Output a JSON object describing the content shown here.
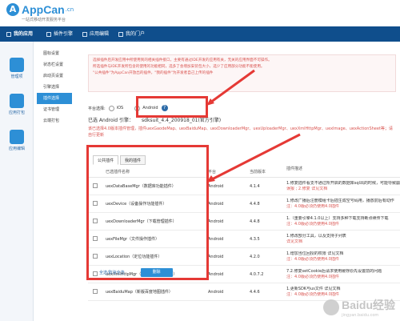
{
  "brand": {
    "logo_text": "AppCan",
    "logo_tld": ".cn",
    "tagline": "一站式移动开发服务平台"
  },
  "nav": {
    "items": [
      {
        "label": "我的应用"
      },
      {
        "label": "插件引擎"
      },
      {
        "label": "应用编辑"
      },
      {
        "label": "我的门户"
      }
    ]
  },
  "rail": {
    "items": [
      {
        "label": "管理项"
      },
      {
        "label": "应用打包"
      },
      {
        "label": "应用编辑"
      }
    ]
  },
  "submenu": {
    "items": [
      {
        "label": "图标设置"
      },
      {
        "label": "状态栏设置"
      },
      {
        "label": "启动页设置"
      },
      {
        "label": "引擎选择"
      },
      {
        "label": "插件选择"
      },
      {
        "label": "证书管理"
      },
      {
        "label": "云端打包"
      }
    ],
    "active_index": 4
  },
  "notice": {
    "line1": "选择插件后开发应用中所使用到的相关插件接口，主要有通过IDE开发的应用有关，无关的应用界面不可操作。",
    "line2": "所选插件与IDE开发所包含的使用的功能相同，选多了会增加安装包大小，选少了应用部分功能不能使用。",
    "line3": "\"公共插件\"为AppCan开放出的插件，\"我的插件\"为开发者自己上传的插件"
  },
  "platform": {
    "label": "平台选择:",
    "options": [
      "iOS",
      "Android"
    ],
    "selected": "Android",
    "help": "?"
  },
  "engine": {
    "label": "已选 Android 引擎：",
    "value": "sdksuit_4.4_200918_01(官方引擎)"
  },
  "warning": "该已选择4.0版本插件管理，插件uexGaodeMap、uexBaiduMap、uexDownloaderMgr、uexUploaderMgr、uexXmlHttpMgr、uexImage、uexActionSheet等；请自行更新",
  "tabs": {
    "items": [
      "公共插件",
      "我的插件"
    ],
    "active_index": 0
  },
  "table": {
    "headers": [
      "",
      "已选插件名称",
      "平台",
      "当前版本",
      "插件描述"
    ],
    "rows": [
      {
        "name": "uexDataBaseMgr（数据库功能插件）",
        "platform": "Android",
        "version": "4.1.4",
        "desc1": "1.修复插件看支不通过所开启的数据库sql出的时候，可能导致崩溃",
        "desc2": "误报 ; 2.修复 详见文档"
      },
      {
        "name": "uexDevice（设备操作功能插件）",
        "platform": "Android",
        "version": "4.4.8",
        "desc1": "1.修改广播后注册模组卡后插生成空号码用，播放前后有动作",
        "desc2": "注：4.0版必须仍使用4.0插件"
      },
      {
        "name": "uexDownloaderMgr（下载管理插件）",
        "platform": "Android",
        "version": "4.4.8",
        "desc1": "1.（重要引擎4.1.0以上）支持多种下载支持断点续传下载",
        "desc2": "注：4.0版必须仍使用4.0插件"
      },
      {
        "name": "uexFileMgr（文件操作插件）",
        "platform": "Android",
        "version": "4.3.5",
        "desc1": "1.修改部分工具，以及支持子列表",
        "desc2": "详见文档"
      },
      {
        "name": "uexLocation（定位功能插件）",
        "platform": "Android",
        "version": "4.2.0",
        "desc1": "1.增加当位回授的权限 详见文档",
        "desc2": "注：4.0版必须仍使用4.0插件"
      },
      {
        "name": "uexXmlHttpMgr（网络异步请求插件）",
        "platform": "Android",
        "version": "4.0.7.2",
        "desc1": "7.2.修复setCookie后请求使用缓存原先设置前的问题",
        "desc2": "注：4.0版必须仍使用4.0插件"
      },
      {
        "name": "uexBaiduMap（新版百度地图插件）",
        "platform": "Android",
        "version": "4.4.6",
        "desc1": "1.更新SDK与us文件 详见文档",
        "desc2": "注：4.0版必须仍使用4.0插件"
      }
    ]
  },
  "footer": {
    "select_all": "全选/取消全选",
    "delete": "删除"
  },
  "watermark": {
    "text": "Baidu经验",
    "sub": "jingyan.baidu.com"
  },
  "colors": {
    "brand_blue": "#2d8fd6",
    "nav_dark": "#0f4e8c",
    "highlight_red": "#e53935"
  }
}
